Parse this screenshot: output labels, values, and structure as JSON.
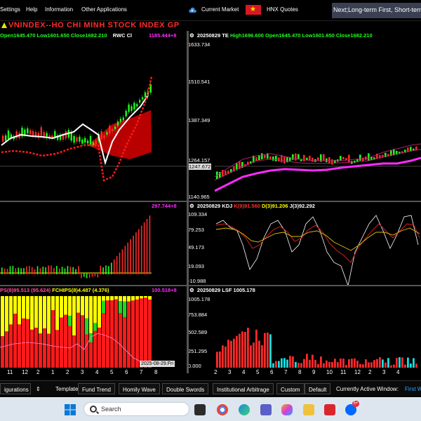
{
  "menu": {
    "items": [
      "Settings",
      "Help",
      "Information",
      "Other Applications"
    ],
    "current_market": "Current Market",
    "hnx_quotes": "HNX Quotes",
    "ticker": "Next;Long-term First, Short-term"
  },
  "main_chart": {
    "title": "VNINDEX--HO CHI MINH STOCK INDEX  GP",
    "info": "Open1645.470 Low1601.650 Close1682.210",
    "overlay": "RWC Cl",
    "overlay_value": "1185.444+8"
  },
  "te_panel": {
    "head_code": "20250829 TE",
    "head_high": "High1696.600",
    "head_rest": "Open1645.470 Low1601.650 Close1682.210",
    "scale": [
      "1633.734",
      "1510.541",
      "1387.349",
      "1264.157",
      "1247.672",
      "1140.965"
    ]
  },
  "osc_panel": {
    "value": "297.744+8"
  },
  "kdj_panel": {
    "head_code": "20250829 KDJ",
    "k": "K(9)91.560",
    "d": "D(3)91.206",
    "j": "J(3)92.292",
    "scale": [
      "109.334",
      "79.253",
      "49.173",
      "19.093",
      "-10.988"
    ]
  },
  "chips_panel": {
    "head_a": "PS(8)95.513 (95.624)",
    "head_b": "FCHIPS(8)4.487 (4.376)",
    "value": "100.518+8"
  },
  "lsf_panel": {
    "head": "20250829 LSF 1005.178",
    "scale": [
      "1005.178",
      "753.884",
      "502.589",
      "251.295",
      "0.000"
    ]
  },
  "left_x_axis": [
    "11",
    "12",
    "2",
    "1",
    "2",
    "3",
    "4",
    "5",
    "6",
    "7",
    "8"
  ],
  "right_x_axis": [
    "2",
    "3",
    "4",
    "5",
    "6",
    "7",
    "8",
    "9",
    "10",
    "11",
    "12",
    "2",
    "3",
    "4"
  ],
  "date_tag": "2025-08-29.Fri",
  "bottom_tabs": [
    "igurations",
    "Template",
    "Fund Trend",
    "Homily Wave",
    "Double Swords",
    "Institutional Arbitrage",
    "Custom",
    "Default",
    "Currently Active Window:",
    "First W"
  ],
  "taskbar": {
    "search_placeholder": "Search",
    "badge": "5+"
  }
}
